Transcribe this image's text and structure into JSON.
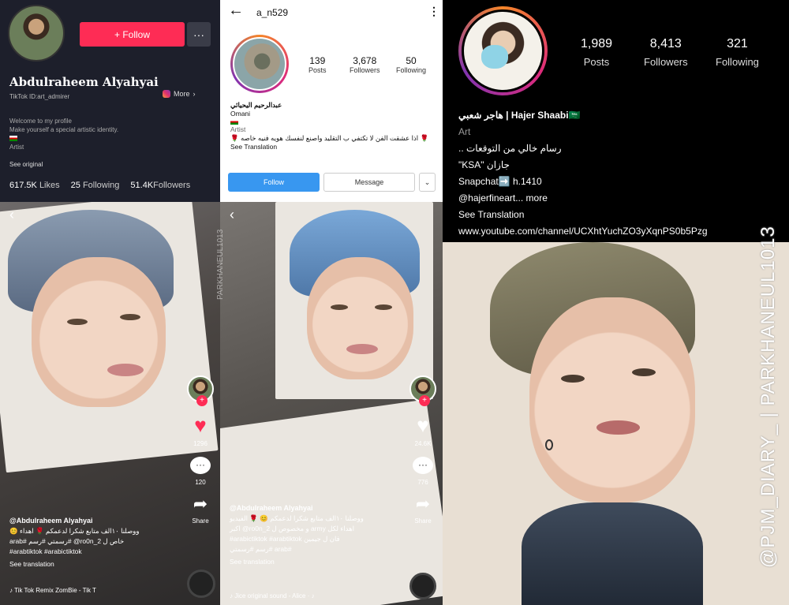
{
  "tiktok_profile": {
    "follow_label": "+ Follow",
    "more_button": "···",
    "name": "Abdulraheem Alyahyai",
    "tiktok_id": "TikTok ID:art_admirer",
    "more_link": "More",
    "bio_line1": "Welcome to my profile",
    "bio_line2": "Make yourself a special artistic identity.",
    "category": "Artist",
    "see_original": "See original",
    "likes_count": "617.5K",
    "likes_label": "Likes",
    "following_count": "25",
    "following_label": "Following",
    "followers_count": "51.4K",
    "followers_label": "Followers"
  },
  "video1": {
    "likes": "1296",
    "comments": "120",
    "share_label": "Share",
    "username": "@Abdulraheem Alyahyai",
    "caption_line1": "ووصلنا ١٠الف متابع شكرا لدعمكم 🌹 اهداء 😊",
    "caption_line2": "خاص ل ro0n_2@ #رسمتي #رسم #arab",
    "caption_line3": "#arabtiktok #arabictiktok",
    "see_translation": "See translation",
    "music": "Tik Tok Remix   ZomBie - Tik T"
  },
  "video2": {
    "likes": "24.6K",
    "comments": "776",
    "share_label": "Share",
    "username": "@Abdulraheem Alyahyai",
    "caption_line1": "ووصلنا ١٠الف متابع شكرا لدعمكم 😊 🌹 الفيديو",
    "caption_line2": "اهداء لكل army و مخصوص ل ro0n_2@ اكبر",
    "caption_line3": "فان ل جيمين arabictiktok #arabtiktok#",
    "caption_line4": "#arab #رسم #رسمتي",
    "see_translation": "See translation",
    "music": "Jice   original sound - Alice · ♪"
  },
  "instagram_light": {
    "username": "a_n529",
    "posts_count": "139",
    "posts_label": "Posts",
    "followers_count": "3,678",
    "followers_label": "Followers",
    "following_count": "50",
    "following_label": "Following",
    "display_name": "عبدالرحيم اليحيائي",
    "location": "Omani",
    "category": "Artist",
    "bio": "🌹 اذا عشقت الفن لا تكتفي ب التقليد واصنع لنفسك هويه فنيه خاصه 🌹",
    "see_translation": "See Translation",
    "follow_label": "Follow",
    "message_label": "Message",
    "dropdown": "⌄"
  },
  "instagram_dark": {
    "posts_count": "1,989",
    "posts_label": "Posts",
    "followers_count": "8,413",
    "followers_label": "Followers",
    "following_count": "321",
    "following_label": "Following",
    "display_name": "هاجر شعبي | Hajer Shaabi🇸🇦",
    "category": "Art",
    "bio_line1": "رسام خالي من التوقعات ..",
    "bio_line2": "\"KSA\" جازان",
    "bio_line3": "Snapchat➡️ h.1410",
    "bio_line4": "@hajerfineart... more",
    "see_translation": "See Translation",
    "link": "www.youtube.com/channel/UCXhtYuchZO3yXqnPS0b5Pzg"
  },
  "watermark": "@PJM_DIARY_ | PARKHANEUL1013",
  "watermark_small": "PARKHANEUL1013"
}
